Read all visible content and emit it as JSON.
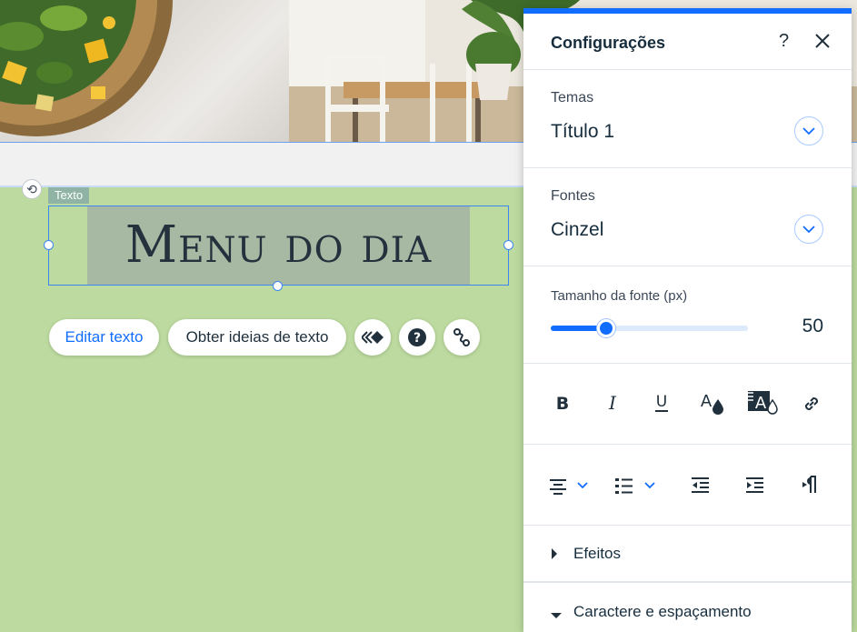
{
  "canvas": {
    "element_tag": "Texto",
    "headline": "Menu do dia"
  },
  "toolbar": {
    "edit_text": "Editar texto",
    "text_ideas": "Obter ideias de texto"
  },
  "settings": {
    "title": "Configurações",
    "help": "?",
    "themes_label": "Temas",
    "themes_value": "Título 1",
    "fonts_label": "Fontes",
    "fonts_value": "Cinzel",
    "font_size_label": "Tamanho da fonte (px)",
    "font_size_value": "50",
    "font_size_fraction": 0.28,
    "effects_label": "Efeitos",
    "spacing_label": "Caractere e espaçamento"
  },
  "colors": {
    "accent": "#116dff",
    "canvas_bg": "#bddba0",
    "highlight": "#a7b9a3"
  }
}
